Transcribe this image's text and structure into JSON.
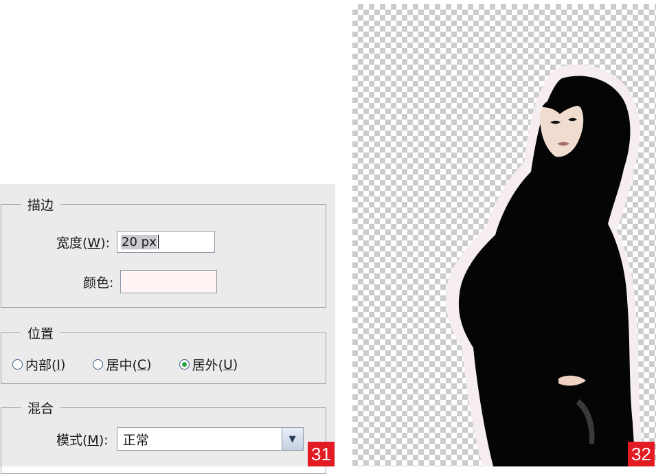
{
  "stroke": {
    "title": "描边",
    "width_label": "宽度(",
    "width_key": "W",
    "width_suffix": "):",
    "width_value": "20 px",
    "color_label": "颜色:",
    "color_value": "#fff3f3"
  },
  "position": {
    "title": "位置",
    "options": [
      {
        "label": "内部(",
        "key": "I",
        "suffix": ")",
        "selected": false
      },
      {
        "label": "居中(",
        "key": "C",
        "suffix": ")",
        "selected": false
      },
      {
        "label": "居外(",
        "key": "U",
        "suffix": ")",
        "selected": true
      }
    ]
  },
  "blend": {
    "title": "混合",
    "mode_label": "模式(",
    "mode_key": "M",
    "mode_suffix": "):",
    "mode_value": "正常"
  },
  "figures": {
    "left_number": "31",
    "right_number": "32"
  },
  "colors": {
    "badge": "#e31b23",
    "radio_selected": "#28a745",
    "stroke_glow": "#f4ecec"
  },
  "icons": {
    "dropdown": "chevron-down-icon"
  }
}
